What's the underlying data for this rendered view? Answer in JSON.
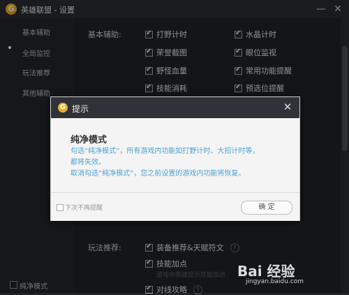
{
  "window": {
    "title": "英雄联盟 - 设置",
    "logo_letter": "G",
    "minimize": "—",
    "close": "✕"
  },
  "sidebar": {
    "items": [
      {
        "label": "基本辅助",
        "active": true
      },
      {
        "label": "全局监控"
      },
      {
        "label": "玩法推荐"
      },
      {
        "label": "其他辅助"
      }
    ],
    "footer_checkbox": "纯净模式"
  },
  "basic": {
    "label": "基本辅助:",
    "options": [
      {
        "label": "打野计时",
        "checked": true
      },
      {
        "label": "水晶计时",
        "checked": true
      },
      {
        "label": "荣誉截图",
        "checked": true
      },
      {
        "label": "眼位监视",
        "checked": true
      },
      {
        "label": "野怪血量",
        "checked": true
      },
      {
        "label": "常用功能提醒",
        "checked": true
      },
      {
        "label": "技能消耗",
        "checked": true
      },
      {
        "label": "预选位提醒",
        "checked": true
      }
    ]
  },
  "play": {
    "label": "玩法推荐:",
    "options": [
      {
        "label": "装备推荐&天赋符文",
        "checked": true,
        "help": "?"
      },
      {
        "label": "技能加点",
        "checked": true,
        "desc": "游戏中英雄提示技能加点"
      },
      {
        "label": "对线攻略",
        "checked": true,
        "help": "?"
      }
    ]
  },
  "dialog": {
    "title": "提示",
    "logo_letter": "G",
    "close": "✕",
    "heading": "纯净模式",
    "body1": "勾选“纯净模式”，所有游戏内功能如打野计时、大招计时等，",
    "body2": "都将失效。",
    "body3": "取消勾选“纯净模式”，您之前设置的游戏内功能将恢复。",
    "checkbox": "下次不再提醒",
    "ok": "确 定"
  },
  "watermark": {
    "brand": "Bai 经验",
    "url": "jingyan.baidu.com"
  }
}
